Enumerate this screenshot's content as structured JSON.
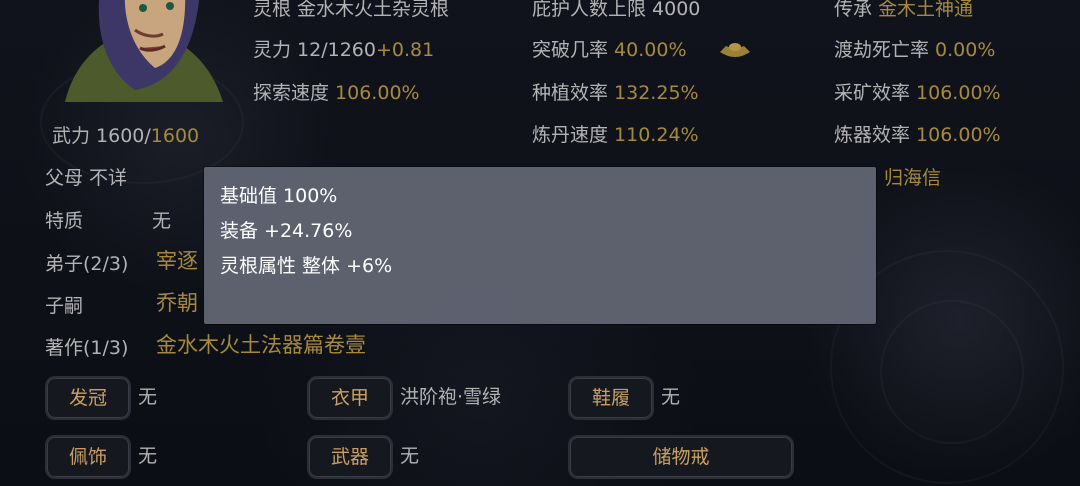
{
  "top_stats": {
    "root": "灵根 金水木火土杂灵根",
    "spirit_label": "灵力 ",
    "spirit_value": "12/1260",
    "spirit_bonus": "+0.81",
    "explore_label": "探索速度 ",
    "explore_value": "106.00%",
    "protect": "庇护人数上限 4000",
    "breakthrough_label": "突破几率 ",
    "breakthrough_value": "40.00%",
    "plant_label": "种植效率 ",
    "plant_value": "132.25%",
    "alchemy_label": "炼丹速度 ",
    "alchemy_value": "110.24%",
    "inherit_label": "传承 ",
    "inherit_value": "金木土神通",
    "tribulation_label": "渡劫死亡率 ",
    "tribulation_value": "0.00%",
    "mining_label": "采矿效率 ",
    "mining_value": "106.00%",
    "forging_label": "炼器效率 ",
    "forging_value": "106.00%"
  },
  "profile": {
    "force_label": "武力 1600/",
    "force_max": "1600",
    "parents": "父母 不详",
    "traits_label": "特质",
    "traits_value": "无",
    "disciples_label": "弟子(2/3)",
    "disciples_value": "宰逐",
    "heirs_label": "子嗣",
    "heirs_value": "乔朝",
    "works_label": "著作(1/3)",
    "works_value": "金水木火土法器篇卷壹",
    "spouse_value": "归海信"
  },
  "equipment": {
    "hat_label": "发冠",
    "hat_value": "无",
    "armor_label": "衣甲",
    "armor_value": "洪阶袍·雪绿",
    "shoes_label": "鞋履",
    "shoes_value": "无",
    "accessory_label": "佩饰",
    "accessory_value": "无",
    "weapon_label": "武器",
    "weapon_value": "无",
    "ring_label": "储物戒"
  },
  "tooltip": {
    "lines": [
      "基础值 100%",
      "装备 +24.76%",
      "灵根属性 整体 +6%"
    ]
  },
  "colors": {
    "gold": "#a58a3e",
    "grey": "#b3b3b3",
    "tooltip_bg": "#60646f"
  },
  "icons": {
    "breakthrough_icon": "gold-ingot-icon"
  }
}
